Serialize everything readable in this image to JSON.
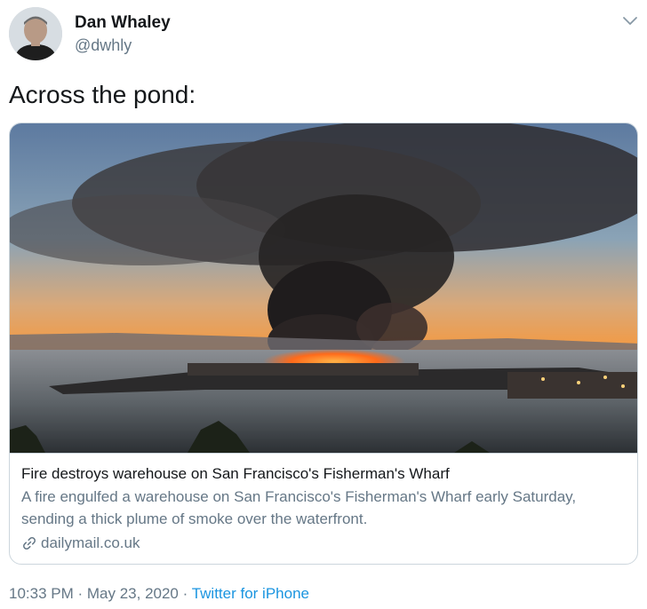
{
  "author": {
    "display_name": "Dan Whaley",
    "handle": "@dwhly",
    "avatar_icon": "user-avatar"
  },
  "menu": {
    "icon": "chevron-down-icon"
  },
  "tweet": {
    "text": "Across the pond:"
  },
  "card": {
    "image_icon": "news-photo",
    "title": "Fire destroys warehouse on San Francisco's Fisherman's Wharf",
    "description": "A fire engulfed a warehouse on San Francisco's Fisherman's Wharf early Saturday, sending a thick plume of smoke over the waterfront.",
    "domain_icon": "link-icon",
    "domain": "dailymail.co.uk"
  },
  "meta": {
    "time": "10:33 PM",
    "separator1": " · ",
    "date": "May 23, 2020",
    "separator2": " · ",
    "source": "Twitter for iPhone"
  },
  "colors": {
    "text": "#14171a",
    "muted": "#657786",
    "link": "#1b95e0",
    "border": "#ccd6dd"
  }
}
